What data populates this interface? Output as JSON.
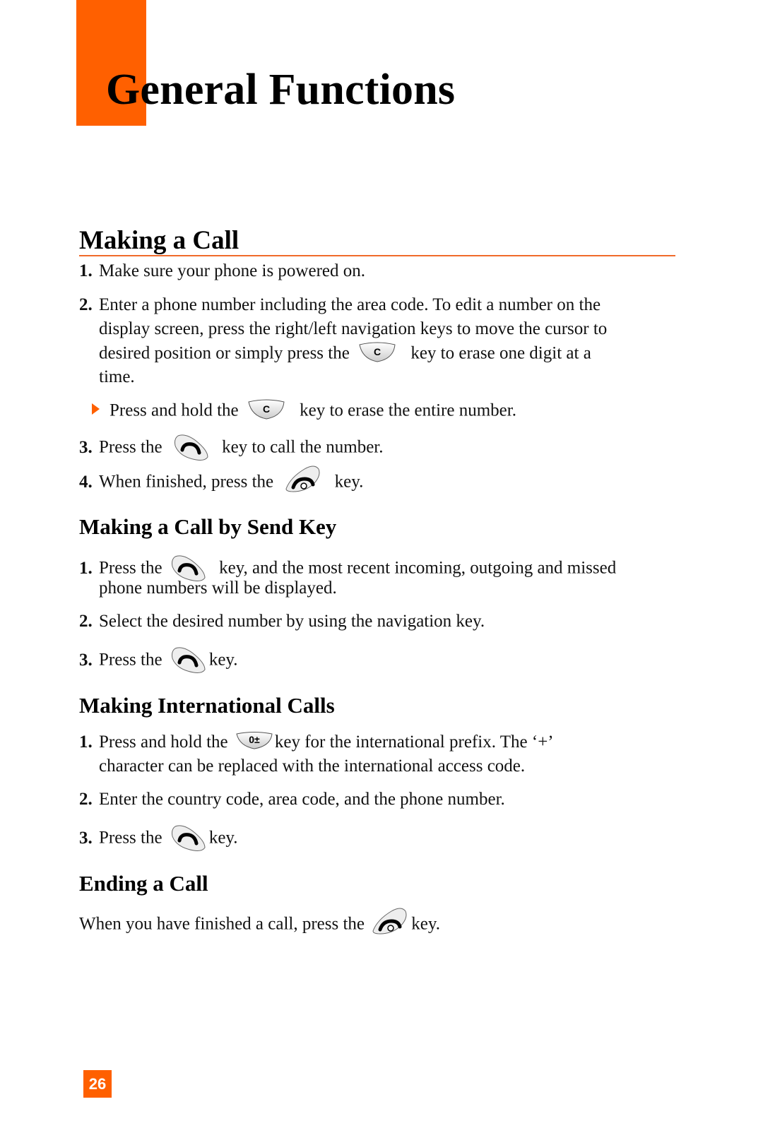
{
  "chapter": {
    "title": "General Functions",
    "accent_color": "#ff6000"
  },
  "sections": [
    {
      "title": "Making a Call",
      "steps": [
        {
          "num": "1.",
          "text": "Make sure your phone is powered on."
        },
        {
          "num": "2.",
          "line1": "Enter a phone number including the area code. To edit a number on the",
          "line2": "display screen, press the right/left navigation keys to move the cursor to",
          "line3_before": "desired position or simply press the",
          "line3_key": "clear-key",
          "line3_after": "key to erase one digit at a",
          "line4": "time."
        },
        {
          "bullet": true,
          "before": "Press and hold the",
          "key": "clear-key",
          "after": "key to erase the entire number."
        },
        {
          "num": "3.",
          "before": "Press the",
          "key": "send-key",
          "after": "key to call the number."
        },
        {
          "num": "4.",
          "before": "When finished, press the",
          "key": "end-key",
          "after": "key."
        }
      ]
    },
    {
      "title": "Making a Call by Send Key",
      "steps": [
        {
          "num": "1.",
          "before": "Press the",
          "key": "send-key",
          "after": "key, and the most recent incoming, outgoing and missed",
          "line2": "phone numbers will be displayed."
        },
        {
          "num": "2.",
          "text": "Select the desired number by using the navigation key."
        },
        {
          "num": "3.",
          "before": "Press the",
          "key": "send-key",
          "after": "key."
        }
      ]
    },
    {
      "title": "Making International Calls",
      "steps": [
        {
          "num": "1.",
          "before": "Press and hold the",
          "key": "zero-plus-key",
          "after": "key for the international prefix. The ‘+’",
          "line2": "character can be replaced with the international access code."
        },
        {
          "num": "2.",
          "text": "Enter the country code, area code, and the phone number."
        },
        {
          "num": "3.",
          "before": "Press the",
          "key": "send-key",
          "after": "key."
        }
      ]
    },
    {
      "title": "Ending a Call",
      "paragraph": {
        "before": "When you have finished a call, press the",
        "key": "end-key",
        "after": "key."
      }
    }
  ],
  "keys": {
    "clear_label": "C",
    "zero_label": "0±"
  },
  "footer": {
    "page_number": "26"
  }
}
